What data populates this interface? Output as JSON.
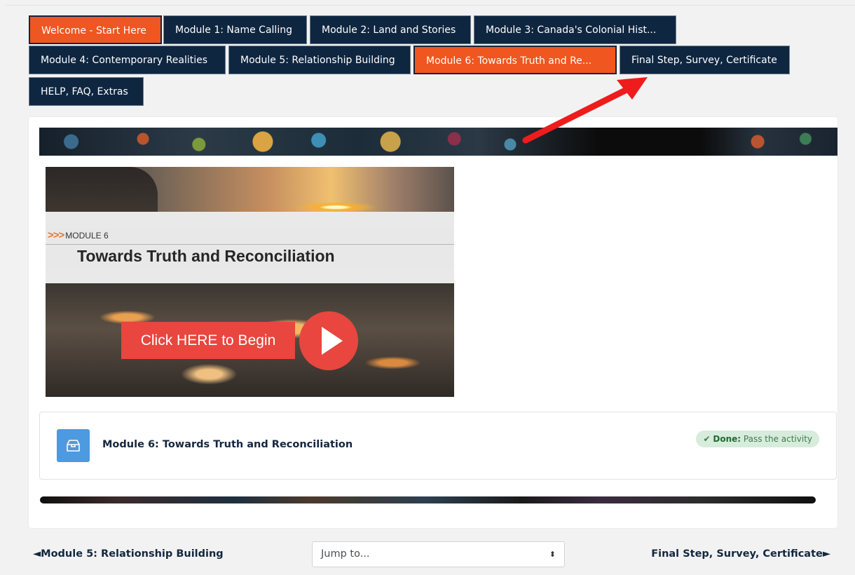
{
  "tabs": [
    {
      "label": "Welcome - Start Here",
      "active": true
    },
    {
      "label": "Module 1: Name Calling",
      "active": false
    },
    {
      "label": "Module 2: Land and Stories",
      "active": false
    },
    {
      "label": "Module 3: Canada's Colonial Hist...",
      "active": false
    },
    {
      "label": "Module 4: Contemporary Realities",
      "active": false
    },
    {
      "label": "Module 5: Relationship Building",
      "active": false
    },
    {
      "label": "Module 6: Towards Truth and Re...",
      "active": true
    },
    {
      "label": "Final Step, Survey, Certificate",
      "active": false
    },
    {
      "label": "HELP, FAQ, Extras",
      "active": false
    }
  ],
  "hero": {
    "module_label": "MODULE 6",
    "title": "Towards Truth and Reconciliation",
    "cta": "Click HERE to Begin"
  },
  "activity": {
    "title": "Module 6: Towards Truth and Reconciliation",
    "icon": "box-icon",
    "completion_label": "Done:",
    "completion_text": "Pass the activity"
  },
  "footer_nav": {
    "prev": "◄Module 5: Relationship Building",
    "jump_placeholder": "Jump to...",
    "next": "Final Step, Survey, Certificate►"
  },
  "colors": {
    "tab_bg": "#0f2640",
    "tab_active": "#f0561f",
    "accent_blue": "#4d9ae0",
    "annotation_arrow": "#ee1c1c"
  }
}
